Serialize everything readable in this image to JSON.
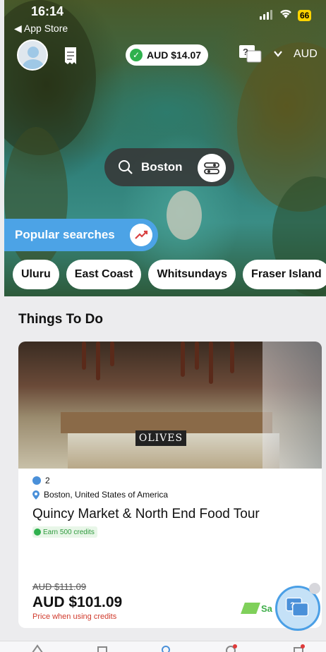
{
  "status_bar": {
    "time": "16:14",
    "back_app": "App Store",
    "battery": "66"
  },
  "header": {
    "credits": "AUD $14.07",
    "currency": "AUD"
  },
  "search": {
    "location": "Boston"
  },
  "popular_searches": {
    "label": "Popular searches",
    "chips": [
      "Uluru",
      "East Coast",
      "Whitsundays",
      "Fraser Island"
    ]
  },
  "section": {
    "title": "Things To Do"
  },
  "card": {
    "image_sign": "OLIVES",
    "duration": "2",
    "location": "Boston, United States of America",
    "title": "Quincy Market & North End Food Tour",
    "earn": "Earn 500 credits",
    "old_price": "AUD $111.09",
    "price": "AUD $101.09",
    "price_note": "Price when using credits",
    "save_label": "Sa"
  },
  "colors": {
    "accent_blue": "#4ca3e6",
    "credit_green": "#2fb14e",
    "price_red": "#d0392b"
  },
  "icons": [
    "avatar",
    "receipt-icon",
    "help-chat-icon",
    "chevron-down-icon",
    "search-icon",
    "filter-icon",
    "trend-icon",
    "clock-icon",
    "pin-icon",
    "chat-fab-icon"
  ]
}
